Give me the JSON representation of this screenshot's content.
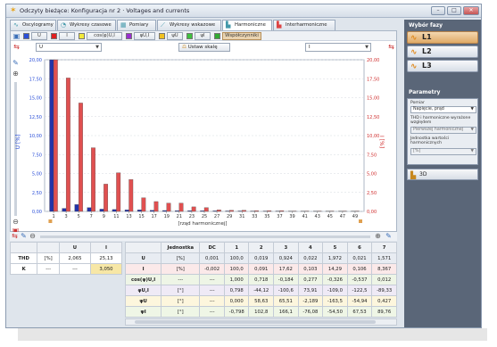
{
  "window": {
    "title": "Odczyty bieżące: Konfiguracja nr 2 · Voltages and currents",
    "min": "–",
    "max": "□",
    "close": "✕"
  },
  "tabs": [
    {
      "label": "Oscylogramy",
      "icon": "waveform-icon"
    },
    {
      "label": "Wykresy czasowe",
      "icon": "clock-icon"
    },
    {
      "label": "Pomiary",
      "icon": "table-icon"
    },
    {
      "label": "Wykresy wskazowe",
      "icon": "vector-icon"
    },
    {
      "label": "Harmoniczne",
      "icon": "bars-icon"
    },
    {
      "label": "Interharmoniczne",
      "icon": "bars-icon"
    }
  ],
  "series_buttons": [
    {
      "label": "U",
      "color": "#2b4fd8",
      "on": false
    },
    {
      "label": "I",
      "color": "#e02020",
      "on": false
    },
    {
      "label": "cos(φ)U,I",
      "color": "#f2e93a",
      "on": false
    },
    {
      "label": "φU,I",
      "color": "#9a2fcf",
      "on": false
    },
    {
      "label": "ψU",
      "color": "#f0c020",
      "on": false
    },
    {
      "label": "ψI",
      "color": "#40c040",
      "on": false
    },
    {
      "label": "Współczynniki",
      "color": "#33aa33",
      "on": true
    }
  ],
  "selectors": {
    "left": "U",
    "right": "I",
    "scale_button": "Ustaw skalę"
  },
  "chart_data": {
    "type": "bar",
    "categories": [
      1,
      3,
      5,
      7,
      9,
      11,
      13,
      15,
      17,
      19,
      21,
      23,
      25,
      27,
      29,
      31,
      33,
      35,
      37,
      39,
      41,
      43,
      45,
      47,
      49
    ],
    "xlabel": "[rząd harmonicznej]",
    "ylabel_left": "U [%]",
    "ylabel_right": "I [%]",
    "ylim": [
      0,
      20
    ],
    "yticks": [
      0,
      2.5,
      5,
      7.5,
      10,
      12.5,
      15,
      17.5,
      20
    ],
    "ytick_labels": [
      "0,00",
      "2,50",
      "5,00",
      "7,50",
      "10,00",
      "12,50",
      "15,00",
      "17,50",
      "20,00"
    ],
    "xtick_labels": [
      "1",
      "3",
      "5",
      "7",
      "9",
      "11",
      "13",
      "15",
      "17",
      "19",
      "21",
      "23",
      "25",
      "27",
      "29",
      "31",
      "33",
      "35",
      "37",
      "39",
      "41",
      "43",
      "45",
      "47",
      "49"
    ],
    "grid": true,
    "series": [
      {
        "name": "U",
        "color": "#2333a8",
        "values": [
          20,
          0.4,
          0.9,
          0.5,
          0.3,
          0.25,
          0.2,
          0.2,
          0.15,
          0.12,
          0.1,
          0.1,
          0.08,
          0.07,
          0.06,
          0.06,
          0.05,
          0.05,
          0.05,
          0.04,
          0.04,
          0.04,
          0.03,
          0.03,
          0.03
        ]
      },
      {
        "name": "I",
        "color": "#e05050",
        "values": [
          20,
          17.6,
          14.3,
          8.4,
          3.6,
          5.1,
          4.2,
          1.8,
          1.3,
          1.1,
          1.1,
          0.6,
          0.5,
          0.2,
          0.15,
          0.15,
          0.1,
          0.1,
          0.1,
          0.05,
          0.05,
          0.05,
          0.05,
          0.05,
          0.05
        ]
      }
    ]
  },
  "right_panel": {
    "phases_title": "Wybór fazy",
    "phases": [
      {
        "label": "L1",
        "on": true
      },
      {
        "label": "L2",
        "on": false
      },
      {
        "label": "L3",
        "on": false
      }
    ],
    "params_title": "Parametry",
    "pomiar_label": "Pomiar",
    "pomiar_value": "Napięcie, prąd",
    "thd_label": "THD i harmoniczne wyrażone względem",
    "thd_value": "Pierwszej harmonicznej",
    "unit_label": "Jednostka wartości harmonicznych",
    "unit_value": "[%]",
    "action_button": "3D"
  },
  "summary_table": {
    "headers": [
      "",
      "",
      "U",
      "I"
    ],
    "rows": [
      [
        "THD",
        "[%]",
        "2,065",
        "25,13"
      ],
      [
        "K",
        "---",
        "---",
        "3,050"
      ]
    ]
  },
  "harm_table": {
    "headers": [
      "",
      "Jednostka",
      "DC",
      "1",
      "2",
      "3",
      "4",
      "5",
      "6",
      "7"
    ],
    "rows": [
      {
        "cls": "rU",
        "cells": [
          "U",
          "[%]",
          "0,001",
          "100,0",
          "0,019",
          "0,924",
          "0,022",
          "1,972",
          "0,021",
          "1,571"
        ]
      },
      {
        "cls": "rI",
        "cells": [
          "I",
          "[%]",
          "-0,002",
          "100,0",
          "0,091",
          "17,62",
          "0,103",
          "14,29",
          "0,106",
          "8,367"
        ]
      },
      {
        "cls": "rC",
        "cells": [
          "cos(φ)U,I",
          "---",
          "---",
          "1,000",
          "0,718",
          "-0,184",
          "0,277",
          "-0,326",
          "-0,537",
          "0,012"
        ]
      },
      {
        "cls": "rP",
        "cells": [
          "φU,I",
          "[°]",
          "---",
          "0,798",
          "-44,12",
          "-100,6",
          "73,91",
          "-109,0",
          "-122,5",
          "-89,33"
        ]
      },
      {
        "cls": "rV",
        "cells": [
          "ψU",
          "[°]",
          "---",
          "0,000",
          "58,63",
          "65,51",
          "-2,189",
          "-163,5",
          "-54,94",
          "0,427"
        ]
      },
      {
        "cls": "rZ",
        "cells": [
          "ψI",
          "[°]",
          "---",
          "-0,798",
          "102,8",
          "166,1",
          "-76,08",
          "-54,50",
          "67,53",
          "89,76"
        ]
      }
    ]
  }
}
